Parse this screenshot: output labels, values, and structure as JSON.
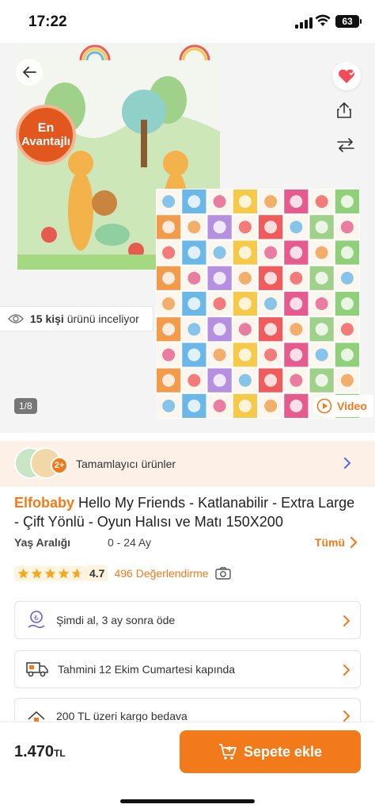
{
  "status_bar": {
    "time": "17:22",
    "battery": "63"
  },
  "gallery": {
    "badge_line1": "En",
    "badge_line2": "Avantajlı",
    "viewers_count": "15 kişi",
    "viewers_text": "ürünü inceliyor",
    "pager": "1/8",
    "video_label": "Video"
  },
  "complementary": {
    "plus": "2+",
    "label": "Tamamlayıcı ürünler"
  },
  "product": {
    "brand": "Elfobaby",
    "name": "Hello My Friends - Katlanabilir - Extra Large - Çift Yönlü - Oyun Halısı ve Matı 150X200",
    "age_key": "Yaş Aralığı",
    "age_value": "0 - 24 Ay",
    "all_label": "Tümü",
    "rating": 4.7,
    "rating_text": "4.7",
    "reviews": "496 Değerlendirme"
  },
  "info_rows": [
    {
      "label": "Şimdi al, 3 ay sonra öde",
      "icon": "installment-icon"
    },
    {
      "label": "Tahmini 12 Ekim Cumartesi kapında",
      "icon": "truck-icon"
    },
    {
      "label": "200 TL üzeri kargo bedava",
      "icon": "free-shipping-icon"
    }
  ],
  "bottom_bar": {
    "price": "1.470",
    "currency": "TL",
    "cart_label": "Sepete ekle"
  },
  "colors": {
    "accent": "#f27a1a",
    "badge": "#e2571e",
    "complementary_bg": "#fdf0e6"
  }
}
